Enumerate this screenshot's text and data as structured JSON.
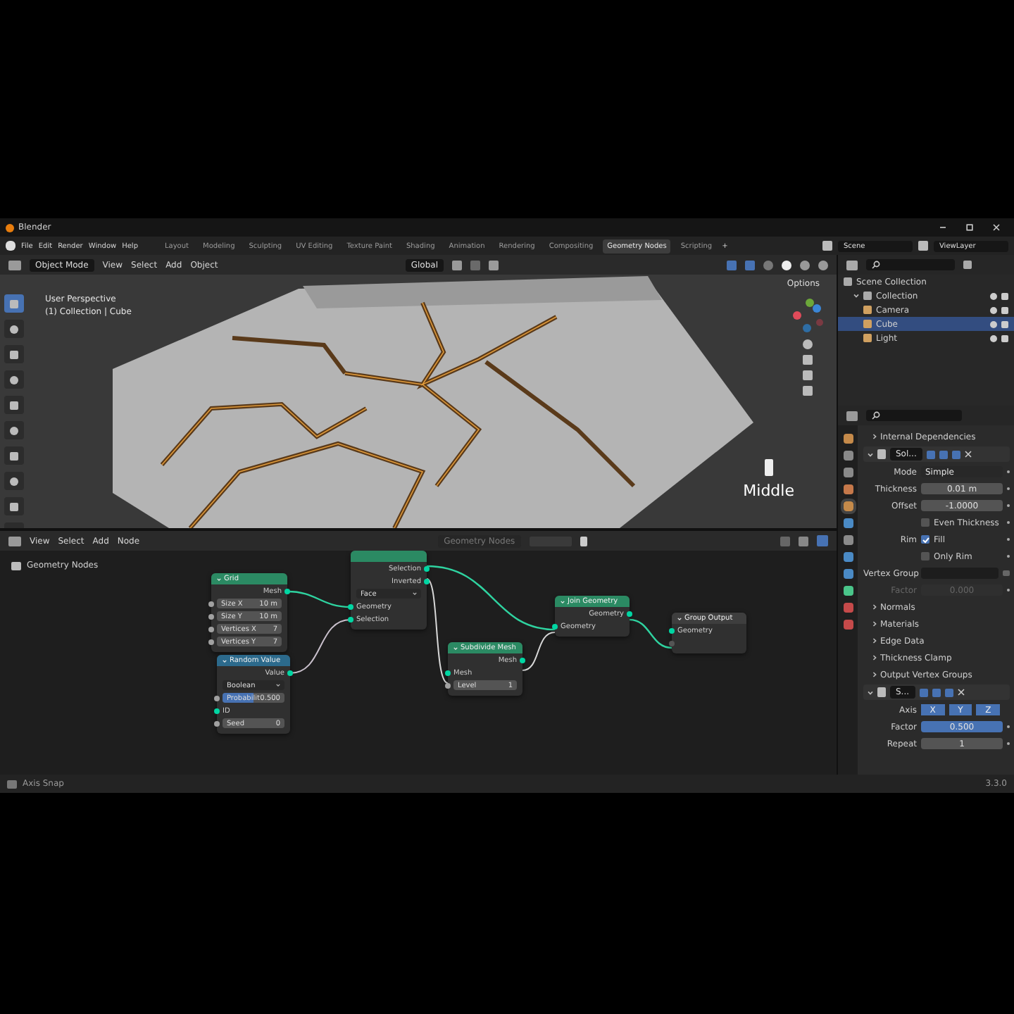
{
  "window": {
    "title": "Blender"
  },
  "menu": [
    "File",
    "Edit",
    "Render",
    "Window",
    "Help"
  ],
  "workspaces": [
    {
      "label": "Layout",
      "selected": false
    },
    {
      "label": "Modeling",
      "selected": false
    },
    {
      "label": "Sculpting",
      "selected": false
    },
    {
      "label": "UV Editing",
      "selected": false
    },
    {
      "label": "Texture Paint",
      "selected": false
    },
    {
      "label": "Shading",
      "selected": false
    },
    {
      "label": "Animation",
      "selected": false
    },
    {
      "label": "Rendering",
      "selected": false
    },
    {
      "label": "Compositing",
      "selected": false
    },
    {
      "label": "Geometry Nodes",
      "selected": true
    },
    {
      "label": "Scripting",
      "selected": false
    }
  ],
  "add_workspace": "+",
  "scene": "Scene",
  "view_layer": "ViewLayer",
  "viewport": {
    "mode": "Object Mode",
    "menu": [
      "View",
      "Select",
      "Add",
      "Object"
    ],
    "orientation": "Global",
    "options": "Options",
    "view_name": "User Perspective",
    "collection_info": "(1) Collection | Cube",
    "overlay_text": "Middle"
  },
  "outliner": {
    "tree": [
      {
        "label": "Scene Collection",
        "children": [
          {
            "label": "Collection",
            "expanded": true,
            "selected": false,
            "children": [
              {
                "label": "Camera",
                "selected": false
              },
              {
                "label": "Cube",
                "selected": true
              },
              {
                "label": "Light",
                "selected": false
              }
            ]
          }
        ]
      }
    ]
  },
  "properties": {
    "top_panel": "Internal Dependencies",
    "modifiers": [
      {
        "name": "Sol...",
        "rows": [
          {
            "kind": "dropdown",
            "label": "Mode",
            "value": "Simple"
          },
          {
            "kind": "number",
            "label": "Thickness",
            "value": "0.01 m",
            "disabled": false,
            "highlighted": false
          },
          {
            "kind": "number",
            "label": "Offset",
            "value": "-1.0000",
            "disabled": false,
            "highlighted": false
          },
          {
            "kind": "checkbox",
            "text": "Even Thickness",
            "checked": false
          },
          {
            "kind": "checkbox",
            "label": "Rim",
            "text": "Fill",
            "checked": true
          },
          {
            "kind": "checkbox",
            "text": "Only Rim",
            "checked": false
          },
          {
            "kind": "field",
            "label": "Vertex Group"
          },
          {
            "kind": "number",
            "label": "Factor",
            "value": "0.000",
            "disabled": true,
            "highlighted": false
          }
        ],
        "panels": [
          "Normals",
          "Materials",
          "Edge Data",
          "Thickness Clamp",
          "Output Vertex Groups"
        ]
      },
      {
        "name": "S...",
        "rows": [
          {
            "kind": "toggles",
            "label": "Axis",
            "options": [
              {
                "label": "X",
                "selected": true
              },
              {
                "label": "Y",
                "selected": true
              },
              {
                "label": "Z",
                "selected": true
              }
            ]
          },
          {
            "kind": "number",
            "label": "Factor",
            "value": "0.500",
            "disabled": false,
            "highlighted": true
          },
          {
            "kind": "number",
            "label": "Repeat",
            "value": "1",
            "disabled": false,
            "highlighted": false
          }
        ]
      }
    ]
  },
  "node_editor": {
    "menu": [
      "View",
      "Select",
      "Add",
      "Node"
    ],
    "tree_name": "Geometry Nodes",
    "breadcrumb": "Geometry Nodes",
    "nodes": [
      {
        "title": "Grid",
        "kind": "geometry",
        "items": [
          {
            "kind": "output",
            "label": "Mesh"
          },
          {
            "kind": "field",
            "label": "Size X",
            "value": "10 m"
          },
          {
            "kind": "field",
            "label": "Size Y",
            "value": "10 m"
          },
          {
            "kind": "field",
            "label": "Vertices X",
            "value": "7"
          },
          {
            "kind": "field",
            "label": "Vertices Y",
            "value": "7"
          }
        ]
      },
      {
        "title": "Random Value",
        "kind": "utility",
        "items": [
          {
            "kind": "output",
            "label": "Value"
          },
          {
            "kind": "dropdown",
            "label": "Boolean"
          },
          {
            "kind": "slider",
            "label": "Probabilit",
            "value": "0.500",
            "level": 0.5
          },
          {
            "kind": "input",
            "label": "ID"
          },
          {
            "kind": "field",
            "label": "Seed",
            "value": "0"
          }
        ]
      },
      {
        "kind": "geometry",
        "items": [
          {
            "kind": "output",
            "label": "Selection"
          },
          {
            "kind": "output",
            "label": "Inverted"
          },
          {
            "kind": "dropdown",
            "label": "Face"
          },
          {
            "kind": "input",
            "label": "Geometry"
          },
          {
            "kind": "input",
            "label": "Selection"
          }
        ]
      },
      {
        "title": "Subdivide Mesh",
        "kind": "geometry",
        "items": [
          {
            "kind": "output",
            "label": "Mesh"
          },
          {
            "kind": "input",
            "label": "Mesh"
          },
          {
            "kind": "field",
            "label": "Level",
            "value": "1"
          }
        ]
      },
      {
        "title": "Join Geometry",
        "kind": "geometry",
        "items": [
          {
            "kind": "output",
            "label": "Geometry"
          },
          {
            "kind": "input",
            "label": "Geometry"
          }
        ]
      },
      {
        "title": "Group Output",
        "kind": "output",
        "items": [
          {
            "kind": "input",
            "label": "Geometry"
          },
          {
            "kind": "empty"
          }
        ]
      }
    ]
  },
  "status_bar": {
    "hint": "Axis Snap",
    "version": "3.3.0"
  }
}
